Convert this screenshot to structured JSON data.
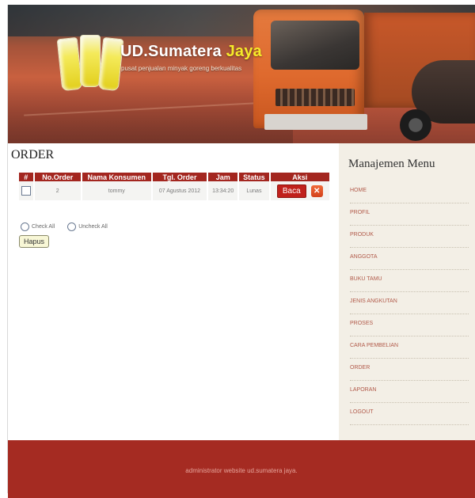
{
  "header": {
    "title_part1": "UD.",
    "title_part2": "Sumatera ",
    "title_part3": "Jaya",
    "subtitle": "pusat penjualan minyak goreng berkualitas"
  },
  "main": {
    "page_title": "ORDER",
    "table": {
      "columns": [
        "#",
        "No.Order",
        "Nama Konsumen",
        "Tgl. Order",
        "Jam",
        "Status",
        "Aksi"
      ],
      "rows": [
        {
          "no_order": "2",
          "nama_konsumen": "tommy",
          "tgl_order": "07 Agustus 2012",
          "jam": "13:34:20",
          "status": "Lunas",
          "read_label": "Baca",
          "delete_icon": "close-icon"
        }
      ]
    },
    "check_all_label": "Check All",
    "uncheck_all_label": "Uncheck All",
    "delete_button_label": "Hapus"
  },
  "sidebar": {
    "title": "Manajemen Menu",
    "items": [
      {
        "label": "HOME"
      },
      {
        "label": "PROFIL"
      },
      {
        "label": "PRODUK"
      },
      {
        "label": "ANGGOTA"
      },
      {
        "label": "BUKU TAMU"
      },
      {
        "label": "JENIS ANGKUTAN"
      },
      {
        "label": "PROSES"
      },
      {
        "label": "CARA PEMBELIAN"
      },
      {
        "label": "ORDER"
      },
      {
        "label": "LAPORAN"
      },
      {
        "label": "LOGOUT"
      }
    ]
  },
  "footer": {
    "text": "administrator website ud.sumatera jaya."
  },
  "colors": {
    "brand_red": "#a3261f",
    "footer_red": "#a52b22",
    "sidebar_bg": "#f3efe6",
    "accent_yellow": "#f6ea2a"
  }
}
